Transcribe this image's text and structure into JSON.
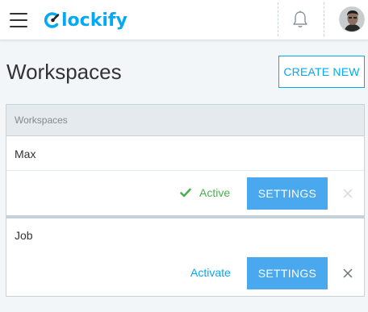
{
  "header": {
    "logo_text": "lockify",
    "brand_color": "#03a9f4",
    "icons": [
      "menu-icon",
      "clockify-logo-icon",
      "bell-icon",
      "avatar"
    ]
  },
  "page": {
    "title": "Workspaces",
    "create_label": "CREATE NEW"
  },
  "table": {
    "header_label": "Workspaces",
    "rows": [
      {
        "name": "Max",
        "status": "Active",
        "settings_label": "SETTINGS",
        "is_active": true
      },
      {
        "name": "Job",
        "status": "Activate",
        "settings_label": "SETTINGS",
        "is_active": false
      }
    ]
  },
  "colors": {
    "accent": "#03a9f4",
    "button": "#4aa8ee",
    "active": "#4caf50",
    "background": "#f2f6f8"
  }
}
